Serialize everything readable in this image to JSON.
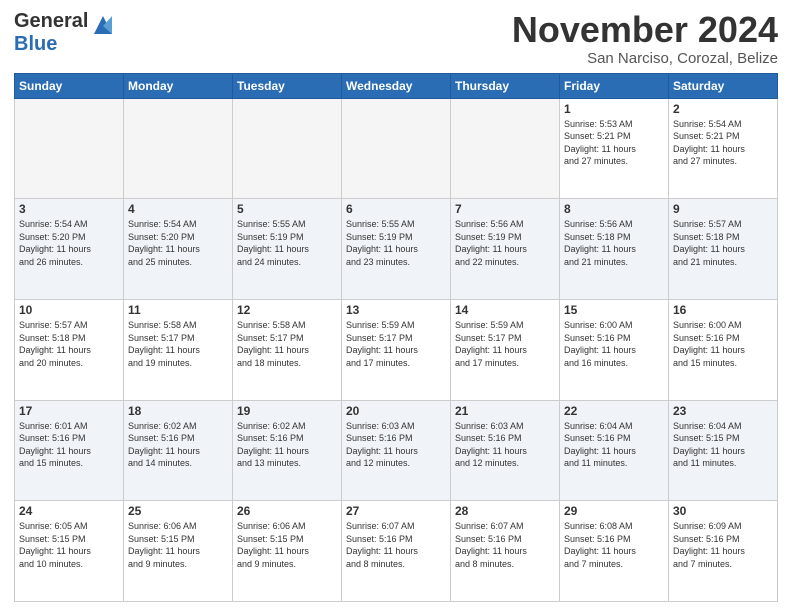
{
  "header": {
    "logo_general": "General",
    "logo_blue": "Blue",
    "month_title": "November 2024",
    "subtitle": "San Narciso, Corozal, Belize"
  },
  "days_of_week": [
    "Sunday",
    "Monday",
    "Tuesday",
    "Wednesday",
    "Thursday",
    "Friday",
    "Saturday"
  ],
  "weeks": [
    {
      "alt": false,
      "days": [
        {
          "num": "",
          "empty": true,
          "info": ""
        },
        {
          "num": "",
          "empty": true,
          "info": ""
        },
        {
          "num": "",
          "empty": true,
          "info": ""
        },
        {
          "num": "",
          "empty": true,
          "info": ""
        },
        {
          "num": "",
          "empty": true,
          "info": ""
        },
        {
          "num": "1",
          "empty": false,
          "info": "Sunrise: 5:53 AM\nSunset: 5:21 PM\nDaylight: 11 hours\nand 27 minutes."
        },
        {
          "num": "2",
          "empty": false,
          "info": "Sunrise: 5:54 AM\nSunset: 5:21 PM\nDaylight: 11 hours\nand 27 minutes."
        }
      ]
    },
    {
      "alt": true,
      "days": [
        {
          "num": "3",
          "empty": false,
          "info": "Sunrise: 5:54 AM\nSunset: 5:20 PM\nDaylight: 11 hours\nand 26 minutes."
        },
        {
          "num": "4",
          "empty": false,
          "info": "Sunrise: 5:54 AM\nSunset: 5:20 PM\nDaylight: 11 hours\nand 25 minutes."
        },
        {
          "num": "5",
          "empty": false,
          "info": "Sunrise: 5:55 AM\nSunset: 5:19 PM\nDaylight: 11 hours\nand 24 minutes."
        },
        {
          "num": "6",
          "empty": false,
          "info": "Sunrise: 5:55 AM\nSunset: 5:19 PM\nDaylight: 11 hours\nand 23 minutes."
        },
        {
          "num": "7",
          "empty": false,
          "info": "Sunrise: 5:56 AM\nSunset: 5:19 PM\nDaylight: 11 hours\nand 22 minutes."
        },
        {
          "num": "8",
          "empty": false,
          "info": "Sunrise: 5:56 AM\nSunset: 5:18 PM\nDaylight: 11 hours\nand 21 minutes."
        },
        {
          "num": "9",
          "empty": false,
          "info": "Sunrise: 5:57 AM\nSunset: 5:18 PM\nDaylight: 11 hours\nand 21 minutes."
        }
      ]
    },
    {
      "alt": false,
      "days": [
        {
          "num": "10",
          "empty": false,
          "info": "Sunrise: 5:57 AM\nSunset: 5:18 PM\nDaylight: 11 hours\nand 20 minutes."
        },
        {
          "num": "11",
          "empty": false,
          "info": "Sunrise: 5:58 AM\nSunset: 5:17 PM\nDaylight: 11 hours\nand 19 minutes."
        },
        {
          "num": "12",
          "empty": false,
          "info": "Sunrise: 5:58 AM\nSunset: 5:17 PM\nDaylight: 11 hours\nand 18 minutes."
        },
        {
          "num": "13",
          "empty": false,
          "info": "Sunrise: 5:59 AM\nSunset: 5:17 PM\nDaylight: 11 hours\nand 17 minutes."
        },
        {
          "num": "14",
          "empty": false,
          "info": "Sunrise: 5:59 AM\nSunset: 5:17 PM\nDaylight: 11 hours\nand 17 minutes."
        },
        {
          "num": "15",
          "empty": false,
          "info": "Sunrise: 6:00 AM\nSunset: 5:16 PM\nDaylight: 11 hours\nand 16 minutes."
        },
        {
          "num": "16",
          "empty": false,
          "info": "Sunrise: 6:00 AM\nSunset: 5:16 PM\nDaylight: 11 hours\nand 15 minutes."
        }
      ]
    },
    {
      "alt": true,
      "days": [
        {
          "num": "17",
          "empty": false,
          "info": "Sunrise: 6:01 AM\nSunset: 5:16 PM\nDaylight: 11 hours\nand 15 minutes."
        },
        {
          "num": "18",
          "empty": false,
          "info": "Sunrise: 6:02 AM\nSunset: 5:16 PM\nDaylight: 11 hours\nand 14 minutes."
        },
        {
          "num": "19",
          "empty": false,
          "info": "Sunrise: 6:02 AM\nSunset: 5:16 PM\nDaylight: 11 hours\nand 13 minutes."
        },
        {
          "num": "20",
          "empty": false,
          "info": "Sunrise: 6:03 AM\nSunset: 5:16 PM\nDaylight: 11 hours\nand 12 minutes."
        },
        {
          "num": "21",
          "empty": false,
          "info": "Sunrise: 6:03 AM\nSunset: 5:16 PM\nDaylight: 11 hours\nand 12 minutes."
        },
        {
          "num": "22",
          "empty": false,
          "info": "Sunrise: 6:04 AM\nSunset: 5:16 PM\nDaylight: 11 hours\nand 11 minutes."
        },
        {
          "num": "23",
          "empty": false,
          "info": "Sunrise: 6:04 AM\nSunset: 5:15 PM\nDaylight: 11 hours\nand 11 minutes."
        }
      ]
    },
    {
      "alt": false,
      "days": [
        {
          "num": "24",
          "empty": false,
          "info": "Sunrise: 6:05 AM\nSunset: 5:15 PM\nDaylight: 11 hours\nand 10 minutes."
        },
        {
          "num": "25",
          "empty": false,
          "info": "Sunrise: 6:06 AM\nSunset: 5:15 PM\nDaylight: 11 hours\nand 9 minutes."
        },
        {
          "num": "26",
          "empty": false,
          "info": "Sunrise: 6:06 AM\nSunset: 5:15 PM\nDaylight: 11 hours\nand 9 minutes."
        },
        {
          "num": "27",
          "empty": false,
          "info": "Sunrise: 6:07 AM\nSunset: 5:16 PM\nDaylight: 11 hours\nand 8 minutes."
        },
        {
          "num": "28",
          "empty": false,
          "info": "Sunrise: 6:07 AM\nSunset: 5:16 PM\nDaylight: 11 hours\nand 8 minutes."
        },
        {
          "num": "29",
          "empty": false,
          "info": "Sunrise: 6:08 AM\nSunset: 5:16 PM\nDaylight: 11 hours\nand 7 minutes."
        },
        {
          "num": "30",
          "empty": false,
          "info": "Sunrise: 6:09 AM\nSunset: 5:16 PM\nDaylight: 11 hours\nand 7 minutes."
        }
      ]
    }
  ]
}
